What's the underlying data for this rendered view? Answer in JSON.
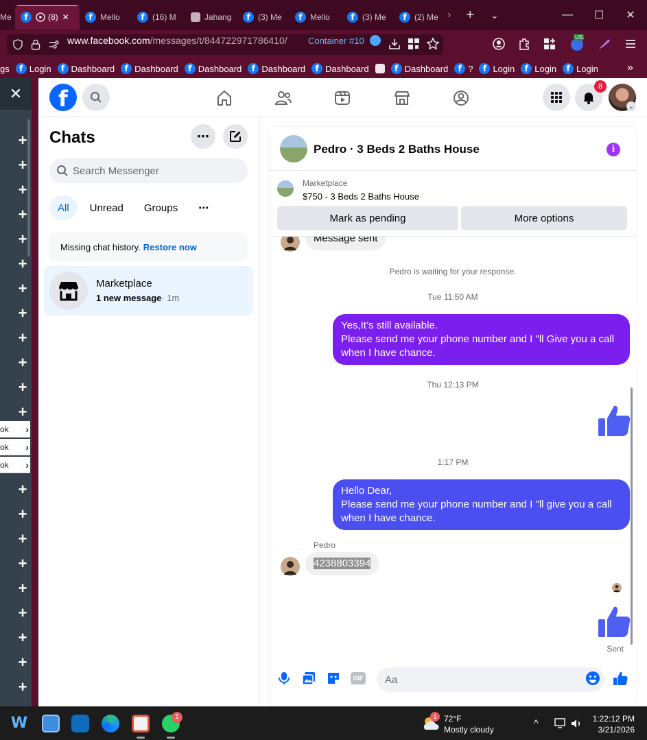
{
  "browser": {
    "tabs": [
      {
        "label": "Me",
        "icon": "gicon"
      },
      {
        "label": "(8)",
        "icon": "fb",
        "active": true
      },
      {
        "label": "Mello",
        "icon": "fb"
      },
      {
        "label": "(16) M",
        "icon": "fb"
      },
      {
        "label": "Jahang",
        "icon": "gicon"
      },
      {
        "label": "(3) Me",
        "icon": "fb"
      },
      {
        "label": "Mello",
        "icon": "fb"
      },
      {
        "label": "(3) Me",
        "icon": "fb"
      },
      {
        "label": "(2) Me",
        "icon": "fb"
      }
    ],
    "url_domain": "www.facebook.com",
    "url_path": "/messages/t/844722971786410/",
    "container_label": "Container #10",
    "ext_badge": "US",
    "bookmarks": [
      "gs",
      "Login",
      "Dashboard",
      "Dashboard",
      "Dashboard",
      "Dashboard",
      "Dashboard",
      "Dashboard",
      "?",
      "Login",
      "Login",
      "Login"
    ]
  },
  "sidebar": {
    "popup_items": [
      "ok",
      "ok",
      "ok"
    ]
  },
  "header": {
    "notification_count": "8"
  },
  "chats": {
    "title": "Chats",
    "search_placeholder": "Search Messenger",
    "filters": [
      "All",
      "Unread",
      "Groups"
    ],
    "missing_text": "Missing chat history.",
    "restore_link": "Restore now",
    "thread": {
      "name": "Marketplace",
      "preview": "1 new message",
      "time": "· 1m"
    }
  },
  "conversation": {
    "title": "Pedro · 3 Beds 2 Baths House",
    "marketplace_label": "Marketplace",
    "listing": "$750 - 3 Beds 2 Baths House",
    "pending_button": "Mark as pending",
    "options_button": "More options",
    "partial_message": "Message sent",
    "waiting_note": "Pedro is waiting for your response.",
    "time1": "Tue 11:50 AM",
    "msg1": "Yes,It’s still available.\nPlease send me your phone number and I \"ll Give you a call when I have chance.",
    "time2": "Thu 12:13 PM",
    "time3": "1:17 PM",
    "msg2": "Hello Dear,\nPlease send me your phone number and I \"ll give you a call when I have chance.",
    "sender_name": "Pedro",
    "phone": "4238803394",
    "status": "Sent",
    "input_placeholder": "Aa"
  },
  "taskbar": {
    "temperature": "72°F",
    "weather": "Mostly cloudy",
    "weather_badge": "1",
    "time": "1:22:12 PM",
    "date": "3/21/2026",
    "whatsapp_badge": "1"
  },
  "colors": {
    "outgoing_purple": "#7b1fef",
    "outgoing_blue": "#4b4ef0",
    "thumb": "#4f5ff2",
    "browser_bg": "#5b0f2e",
    "fb_blue": "#0866ff"
  }
}
